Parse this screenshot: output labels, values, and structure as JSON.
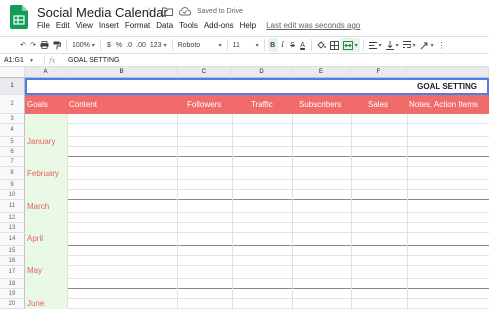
{
  "app": {
    "title": "Social Media Calendar",
    "saved_status": "Saved to Drive",
    "last_edit": "Last edit was seconds ago",
    "menu": [
      "File",
      "Edit",
      "View",
      "Insert",
      "Format",
      "Data",
      "Tools",
      "Add-ons",
      "Help"
    ]
  },
  "toolbar": {
    "zoom": "100%",
    "currency": "$",
    "percent": "%",
    "decrease_decimals": ".0",
    "increase_decimals": ".00",
    "more_formats": "123",
    "font": "Roboto",
    "font_size": "11",
    "bold": "B",
    "italic": "I",
    "strikethrough": "S",
    "text_color": "A"
  },
  "formula_bar": {
    "name_box": "A1:G1",
    "fx": "fx",
    "content": "GOAL SETTING"
  },
  "columns": [
    "A",
    "B",
    "C",
    "D",
    "E",
    "F"
  ],
  "rows": [
    "1",
    "2",
    "3",
    "4",
    "5",
    "6",
    "7",
    "8",
    "9",
    "10",
    "11",
    "12",
    "13",
    "14",
    "15",
    "16",
    "17",
    "18",
    "19",
    "20"
  ],
  "sheet": {
    "title": "GOAL SETTING",
    "headers": [
      "Goals",
      "Content",
      "Followers",
      "Traffic",
      "Subscribers",
      "Sales",
      "Notes, Action Items"
    ],
    "months": [
      "January",
      "February",
      "March",
      "April",
      "May",
      "June"
    ]
  },
  "colors": {
    "header_fill": "#f26b6b",
    "goals_fill": "#eaf8e6",
    "month_text": "#e8605f",
    "selection": "#4a7ee8",
    "sheets_green": "#0f9d58"
  }
}
